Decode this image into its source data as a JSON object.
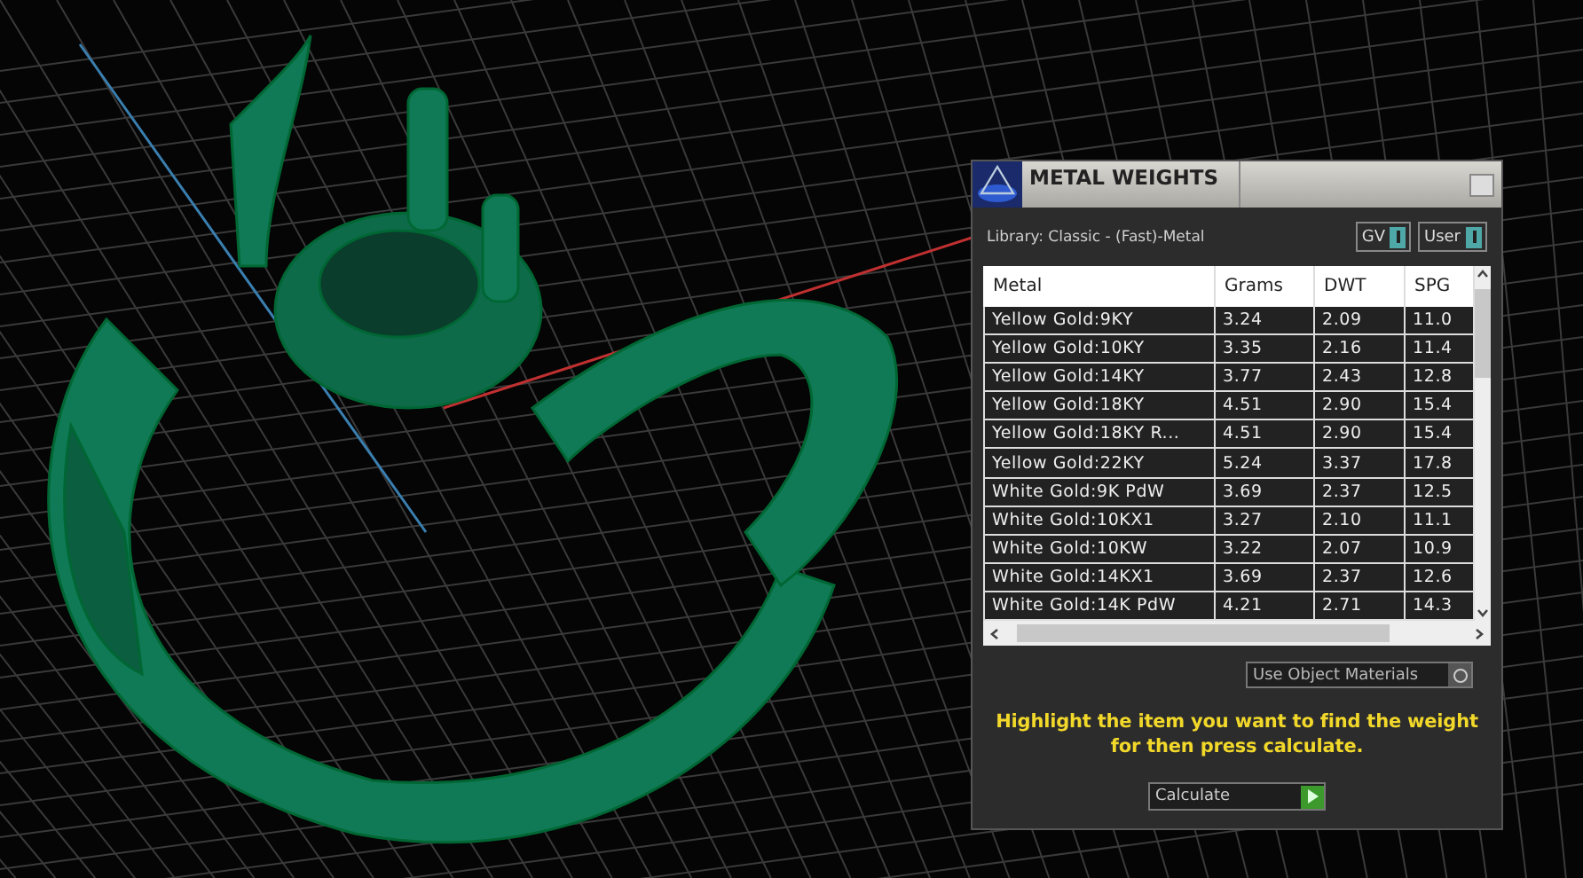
{
  "panel": {
    "title": "METAL WEIGHTS",
    "library": "Library: Classic - (Fast)-Metal",
    "toggles": [
      {
        "label": "GV",
        "on": true
      },
      {
        "label": "User",
        "on": true
      }
    ],
    "table": {
      "columns": [
        "Metal",
        "Grams",
        "DWT",
        "SPG"
      ],
      "rows": [
        [
          "Yellow Gold:9KY",
          "3.24",
          "2.09",
          "11.0"
        ],
        [
          "Yellow Gold:10KY",
          "3.35",
          "2.16",
          "11.4"
        ],
        [
          "Yellow Gold:14KY",
          "3.77",
          "2.43",
          "12.8"
        ],
        [
          "Yellow Gold:18KY",
          "4.51",
          "2.90",
          "15.4"
        ],
        [
          "Yellow Gold:18KY R...",
          "4.51",
          "2.90",
          "15.4"
        ],
        [
          "Yellow Gold:22KY",
          "5.24",
          "3.37",
          "17.8"
        ],
        [
          "White Gold:9K PdW",
          "3.69",
          "2.37",
          "12.5"
        ],
        [
          "White Gold:10KX1",
          "3.27",
          "2.10",
          "11.1"
        ],
        [
          "White Gold:10KW",
          "3.22",
          "2.07",
          "10.9"
        ],
        [
          "White Gold:14KX1",
          "3.69",
          "2.37",
          "12.6"
        ],
        [
          "White Gold:14K PdW",
          "4.21",
          "2.71",
          "14.3"
        ]
      ]
    },
    "use_object_materials": {
      "label": "Use Object Materials",
      "checked": false
    },
    "message": "Highlight the item you want to find the weight for then press calculate.",
    "calculate_button": "Calculate"
  }
}
